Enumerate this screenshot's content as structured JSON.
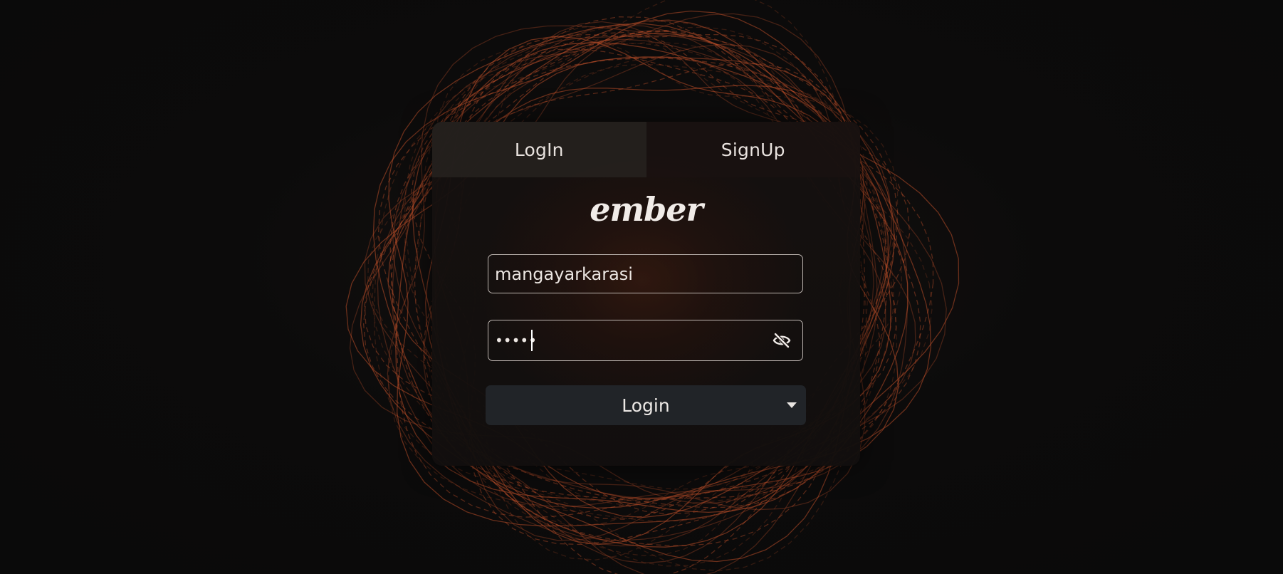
{
  "tabs": {
    "login_label": "LogIn",
    "signup_label": "SignUp"
  },
  "brand": {
    "logo_text": "ember"
  },
  "form": {
    "username_value": "mangayarkarasi",
    "password_masked": "•••••",
    "toggle_icon": "eye-slash-icon"
  },
  "actions": {
    "login_label": "Login",
    "dropdown_icon": "caret-down-icon"
  },
  "colors": {
    "accent": "#c2502a",
    "background": "#0b0b0b",
    "button": "#212428"
  }
}
